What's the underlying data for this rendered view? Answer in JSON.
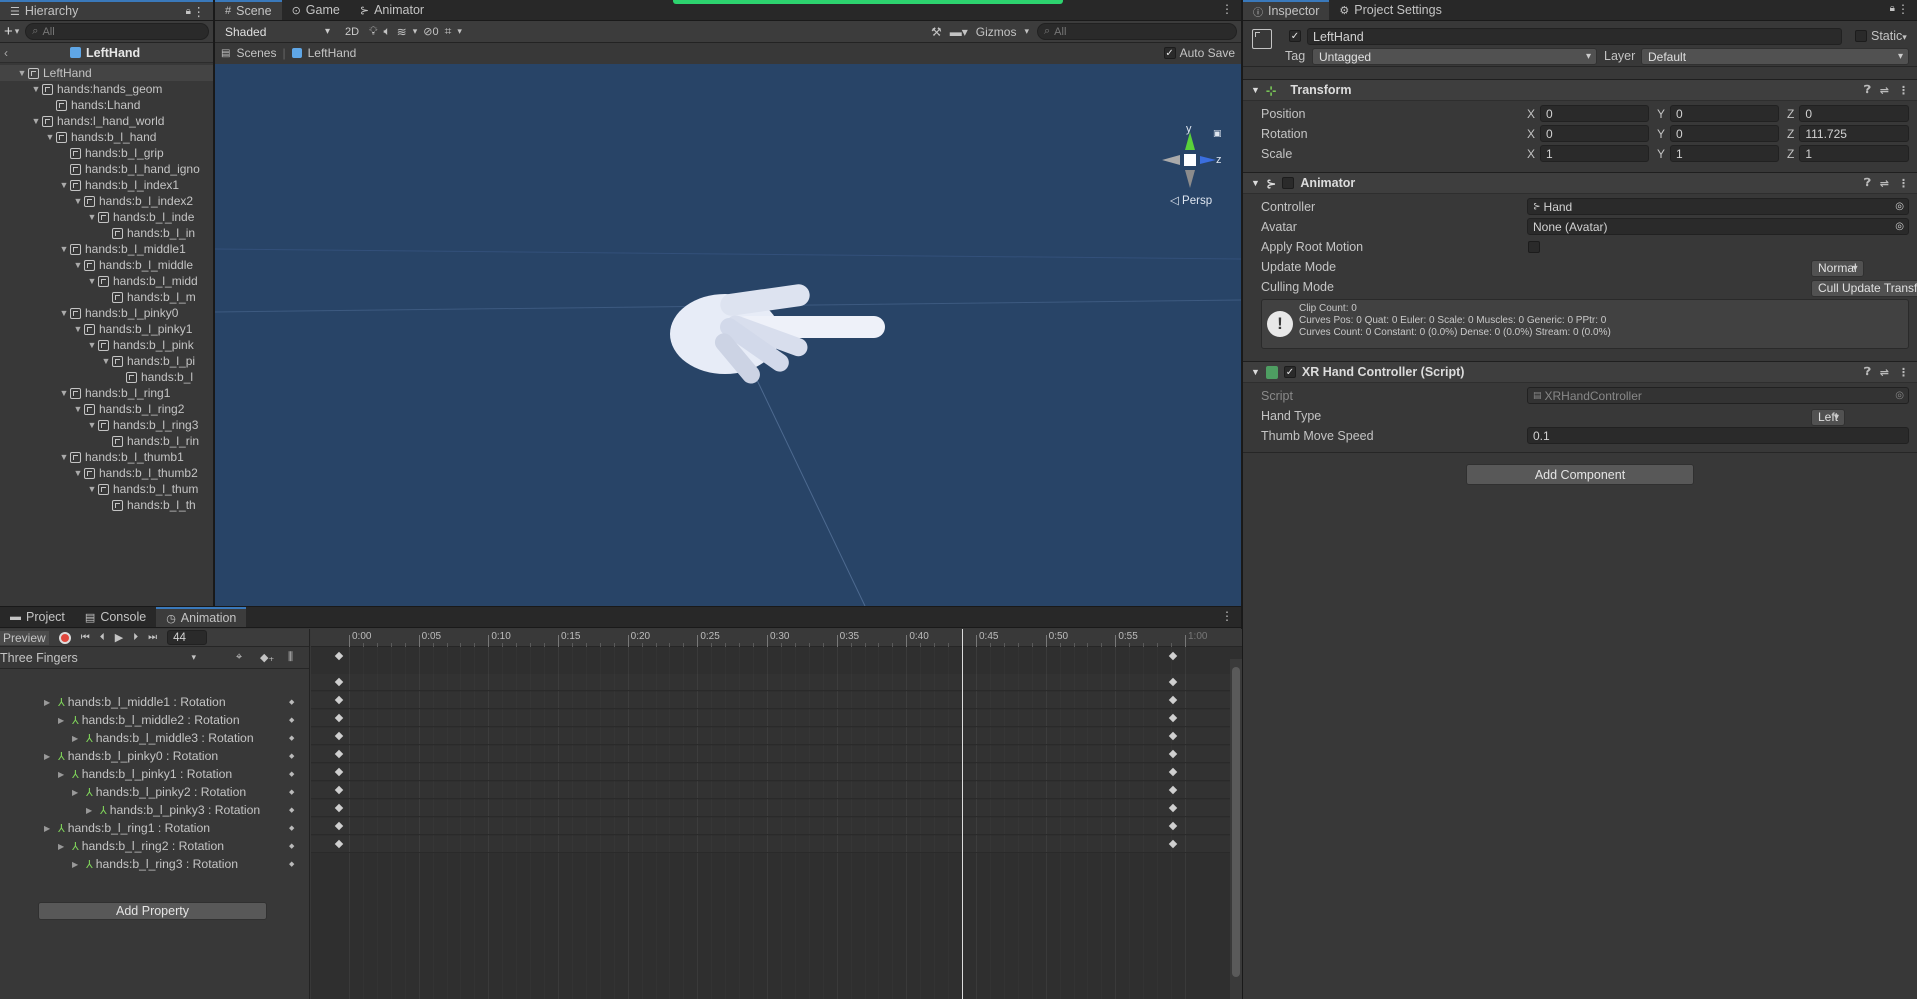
{
  "hierarchy": {
    "tab_label": "Hierarchy",
    "search_placeholder": "All",
    "scene_root": "LeftHand",
    "items": [
      {
        "label": "LeftHand",
        "depth": 0,
        "expanded": true
      },
      {
        "label": "hands:hands_geom",
        "depth": 1,
        "expanded": true
      },
      {
        "label": "hands:Lhand",
        "depth": 2,
        "expanded": false
      },
      {
        "label": "hands:l_hand_world",
        "depth": 1,
        "expanded": true
      },
      {
        "label": "hands:b_l_hand",
        "depth": 2,
        "expanded": true
      },
      {
        "label": "hands:b_l_grip",
        "depth": 3,
        "expanded": false
      },
      {
        "label": "hands:b_l_hand_igno",
        "depth": 3,
        "expanded": false
      },
      {
        "label": "hands:b_l_index1",
        "depth": 3,
        "expanded": true
      },
      {
        "label": "hands:b_l_index2",
        "depth": 4,
        "expanded": true
      },
      {
        "label": "hands:b_l_inde",
        "depth": 5,
        "expanded": true
      },
      {
        "label": "hands:b_l_in",
        "depth": 6,
        "expanded": false
      },
      {
        "label": "hands:b_l_middle1",
        "depth": 3,
        "expanded": true
      },
      {
        "label": "hands:b_l_middle",
        "depth": 4,
        "expanded": true
      },
      {
        "label": "hands:b_l_midd",
        "depth": 5,
        "expanded": true
      },
      {
        "label": "hands:b_l_m",
        "depth": 6,
        "expanded": false
      },
      {
        "label": "hands:b_l_pinky0",
        "depth": 3,
        "expanded": true
      },
      {
        "label": "hands:b_l_pinky1",
        "depth": 4,
        "expanded": true
      },
      {
        "label": "hands:b_l_pink",
        "depth": 5,
        "expanded": true
      },
      {
        "label": "hands:b_l_pi",
        "depth": 6,
        "expanded": true
      },
      {
        "label": "hands:b_l",
        "depth": 7,
        "expanded": false
      },
      {
        "label": "hands:b_l_ring1",
        "depth": 3,
        "expanded": true
      },
      {
        "label": "hands:b_l_ring2",
        "depth": 4,
        "expanded": true
      },
      {
        "label": "hands:b_l_ring3",
        "depth": 5,
        "expanded": true
      },
      {
        "label": "hands:b_l_rin",
        "depth": 6,
        "expanded": false
      },
      {
        "label": "hands:b_l_thumb1",
        "depth": 3,
        "expanded": true
      },
      {
        "label": "hands:b_l_thumb2",
        "depth": 4,
        "expanded": true
      },
      {
        "label": "hands:b_l_thum",
        "depth": 5,
        "expanded": true
      },
      {
        "label": "hands:b_l_th",
        "depth": 6,
        "expanded": false
      }
    ]
  },
  "scene": {
    "tabs": [
      "Scene",
      "Game",
      "Animator"
    ],
    "draw_mode": "Shaded",
    "toggle_2d": "2D",
    "hidden_count": "0",
    "gizmos": "Gizmos",
    "search_placeholder": "All",
    "breadcrumb_root": "Scenes",
    "breadcrumb_object": "LeftHand",
    "auto_save": "Auto Save",
    "persp": "Persp",
    "axis_y": "y",
    "axis_z": "z",
    "bg_color": "#284467"
  },
  "animation": {
    "tabs": [
      "Project",
      "Console",
      "Animation"
    ],
    "preview": "Preview",
    "frame": "44",
    "clip": "Three Fingers",
    "ticks": [
      "0:00",
      "0:05",
      "0:10",
      "0:15",
      "0:20",
      "0:25",
      "0:30",
      "0:35",
      "0:40",
      "0:45",
      "0:50",
      "0:55",
      "1:00"
    ],
    "properties": [
      {
        "label": "hands:b_l_middle1 : Rotation",
        "depth": 0
      },
      {
        "label": "hands:b_l_middle2 : Rotation",
        "depth": 1
      },
      {
        "label": "hands:b_l_middle3 : Rotation",
        "depth": 2
      },
      {
        "label": "hands:b_l_pinky0 : Rotation",
        "depth": 0
      },
      {
        "label": "hands:b_l_pinky1 : Rotation",
        "depth": 1
      },
      {
        "label": "hands:b_l_pinky2 : Rotation",
        "depth": 2
      },
      {
        "label": "hands:b_l_pinky3 : Rotation",
        "depth": 3
      },
      {
        "label": "hands:b_l_ring1 : Rotation",
        "depth": 0
      },
      {
        "label": "hands:b_l_ring2 : Rotation",
        "depth": 1
      },
      {
        "label": "hands:b_l_ring3 : Rotation",
        "depth": 2
      }
    ],
    "add_property": "Add Property",
    "playhead_fraction": 0.733
  },
  "inspector": {
    "tabs": [
      "Inspector",
      "Project Settings"
    ],
    "object_name": "LeftHand",
    "static_label": "Static",
    "tag_label": "Tag",
    "tag_value": "Untagged",
    "layer_label": "Layer",
    "layer_value": "Default",
    "transform": {
      "title": "Transform",
      "position": {
        "label": "Position",
        "x": "0",
        "y": "0",
        "z": "0"
      },
      "rotation": {
        "label": "Rotation",
        "x": "0",
        "y": "0",
        "z": "111.725"
      },
      "scale": {
        "label": "Scale",
        "x": "1",
        "y": "1",
        "z": "1"
      }
    },
    "animator": {
      "title": "Animator",
      "controller_label": "Controller",
      "controller_value": "Hand",
      "avatar_label": "Avatar",
      "avatar_value": "None (Avatar)",
      "root_motion_label": "Apply Root Motion",
      "update_mode_label": "Update Mode",
      "update_mode_value": "Normal",
      "culling_mode_label": "Culling Mode",
      "culling_mode_value": "Cull Update Transforms",
      "info_line1": "Clip Count: 0",
      "info_line2": "Curves Pos: 0 Quat: 0 Euler: 0 Scale: 0 Muscles: 0 Generic: 0 PPtr: 0",
      "info_line3": "Curves Count: 0 Constant: 0 (0.0%) Dense: 0 (0.0%) Stream: 0 (0.0%)"
    },
    "xr": {
      "title": "XR Hand Controller (Script)",
      "script_label": "Script",
      "script_value": "XRHandController",
      "hand_type_label": "Hand Type",
      "hand_type_value": "Left",
      "speed_label": "Thumb Move Speed",
      "speed_value": "0.1"
    },
    "add_component": "Add Component"
  }
}
